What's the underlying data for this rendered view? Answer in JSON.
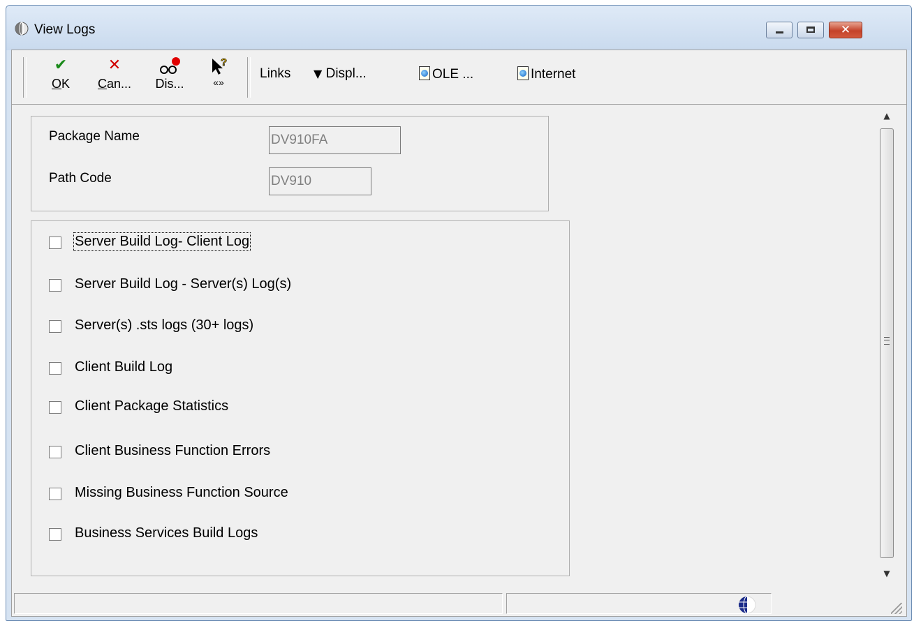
{
  "window": {
    "title": "View Logs"
  },
  "toolbar": {
    "ok": {
      "label_accel": "O",
      "label_rest": "K",
      "icon": "checkmark-icon",
      "color": "#1a8a1a"
    },
    "cancel": {
      "label_accel": "C",
      "label_rest": "an...",
      "icon": "x-icon",
      "color": "#d00000"
    },
    "display": {
      "label": "Dis...",
      "icon": "glasses-icon"
    },
    "help": {
      "label": "«»",
      "icon": "help-pointer-icon"
    },
    "links_label": "Links",
    "display_menu_label": "Displ...",
    "ole_label": "OLE ...",
    "internet_label": "Internet"
  },
  "header_fields": {
    "package_name": {
      "label": "Package Name",
      "value": "DV910FA"
    },
    "path_code": {
      "label": "Path Code",
      "value": "DV910"
    }
  },
  "log_options": [
    {
      "label": "Server Build Log- Client Log",
      "checked": false,
      "focused": true
    },
    {
      "label": "Server Build Log - Server(s) Log(s)",
      "checked": false
    },
    {
      "label": "Server(s) .sts logs (30+ logs)",
      "checked": false
    },
    {
      "label": "Client Build Log",
      "checked": false
    },
    {
      "label": "Client Package Statistics",
      "checked": false
    },
    {
      "label": "Client Business Function Errors",
      "checked": false
    },
    {
      "label": "Missing Business Function Source",
      "checked": false
    },
    {
      "label": "Business Services Build Logs",
      "checked": false
    }
  ],
  "status_bar": {
    "pane1_text": "",
    "pane2_text": "",
    "icon": "jde-globe-icon"
  }
}
